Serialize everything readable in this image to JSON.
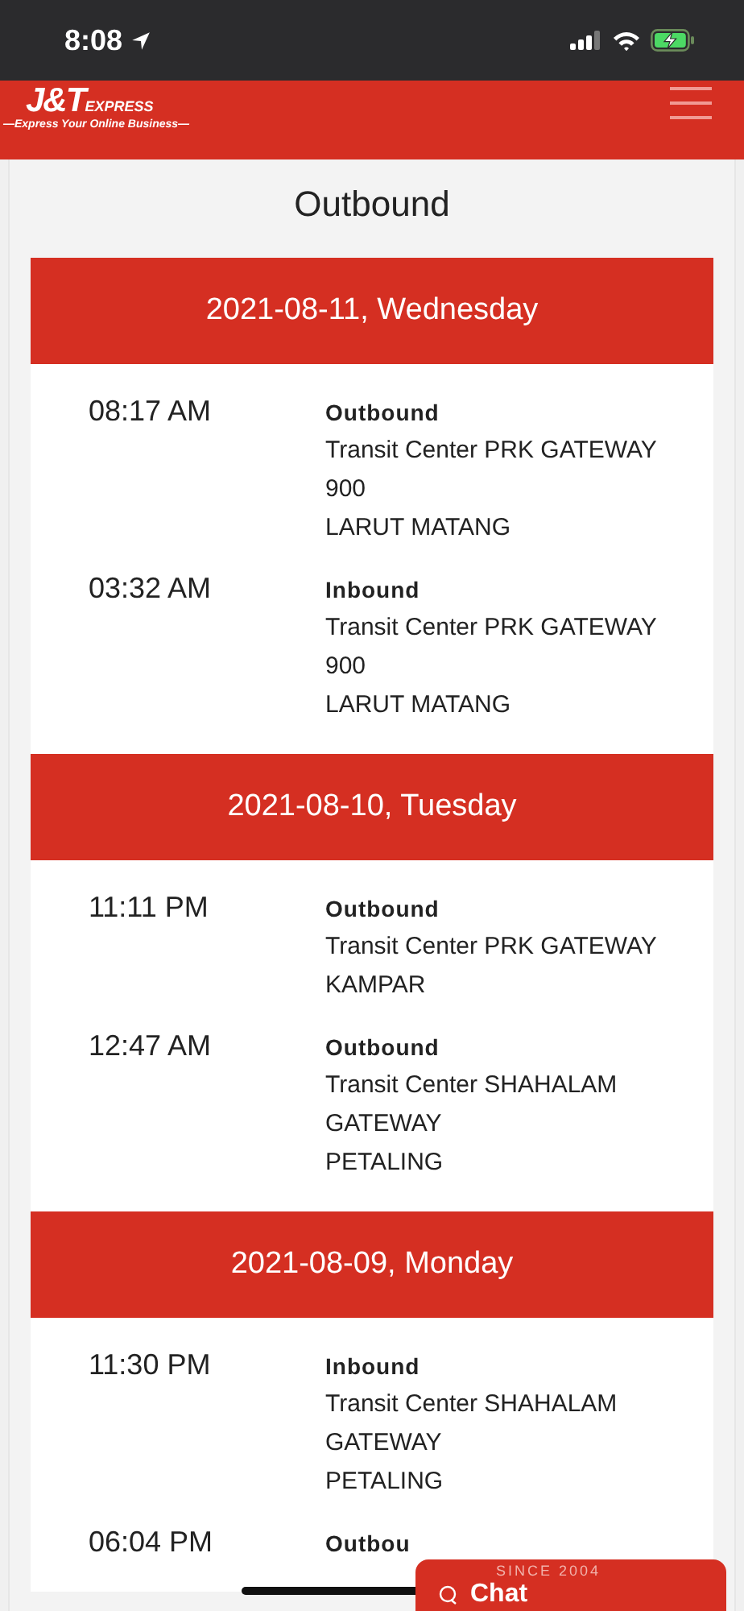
{
  "status_bar": {
    "time": "8:08"
  },
  "header": {
    "logo": "J&T",
    "logo_suffix": "EXPRESS",
    "tagline": "—Express Your Online Business—"
  },
  "title": "Outbound",
  "days": [
    {
      "date": "2021-08-11, Wednesday",
      "events": [
        {
          "time": "08:17 AM",
          "status": "Outbound",
          "lines": [
            "Transit Center PRK GATEWAY",
            "900",
            "LARUT MATANG"
          ]
        },
        {
          "time": "03:32 AM",
          "status": "Inbound",
          "lines": [
            "Transit Center PRK GATEWAY",
            "900",
            "LARUT MATANG"
          ]
        }
      ]
    },
    {
      "date": "2021-08-10, Tuesday",
      "events": [
        {
          "time": "11:11 PM",
          "status": "Outbound",
          "lines": [
            "Transit Center PRK GATEWAY",
            "KAMPAR"
          ]
        },
        {
          "time": "12:47 AM",
          "status": "Outbound",
          "lines": [
            "Transit Center SHAHALAM",
            "GATEWAY",
            "PETALING"
          ]
        }
      ]
    },
    {
      "date": "2021-08-09, Monday",
      "events": [
        {
          "time": "11:30 PM",
          "status": "Inbound",
          "lines": [
            "Transit Center SHAHALAM",
            "GATEWAY",
            "PETALING"
          ]
        },
        {
          "time": "06:04 PM",
          "status": "Outbou"
        }
      ]
    }
  ],
  "chat": {
    "tagline": "SINCE 2004",
    "label": "Chat"
  }
}
